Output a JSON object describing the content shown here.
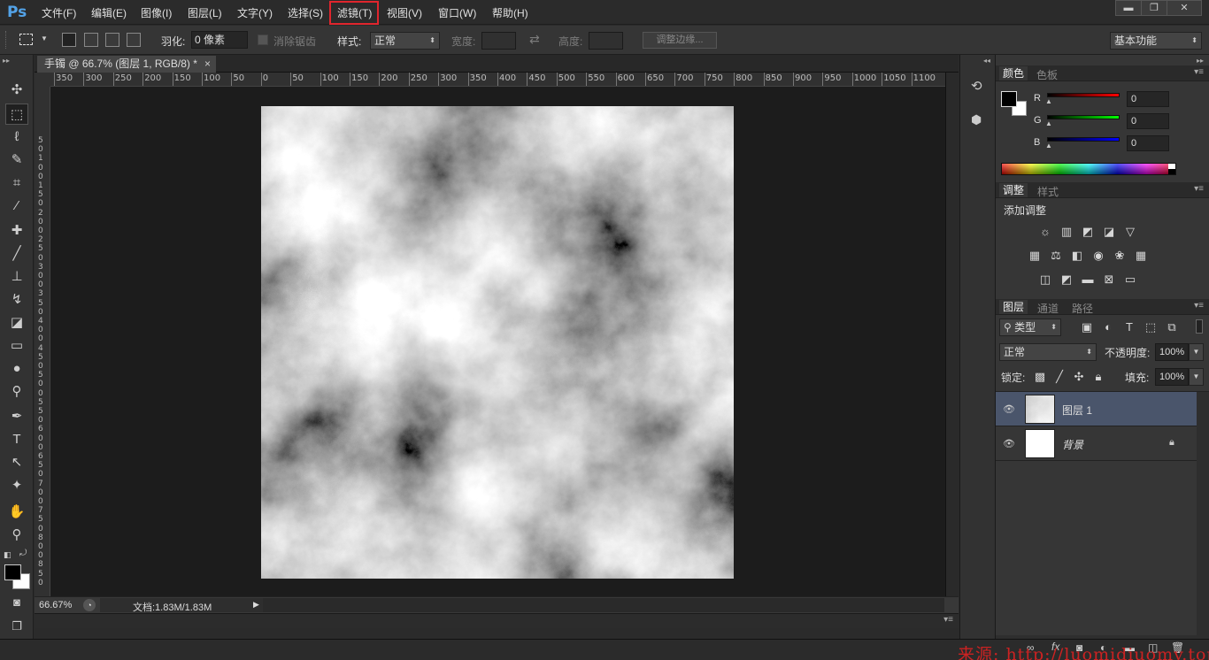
{
  "app": {
    "logo": "Ps"
  },
  "menu": [
    "文件(F)",
    "编辑(E)",
    "图像(I)",
    "图层(L)",
    "文字(Y)",
    "选择(S)",
    "滤镜(T)",
    "视图(V)",
    "窗口(W)",
    "帮助(H)"
  ],
  "window_controls": {
    "minimize": "▬",
    "restore": "❐",
    "close": "✕"
  },
  "options": {
    "feather_label": "羽化:",
    "feather_value": "0 像素",
    "antialias_label": "消除锯齿",
    "style_label": "样式:",
    "style_value": "正常",
    "width_label": "宽度:",
    "height_label": "高度:",
    "refine_edge": "调整边缘...",
    "workspace": "基本功能"
  },
  "document": {
    "tab_title": "手镯 @ 66.7% (图层 1, RGB/8) *",
    "tab_close": "×",
    "zoom": "66.67%",
    "doc_info": "文档:1.83M/1.83M"
  },
  "ruler_h": [
    "350",
    "300",
    "250",
    "200",
    "150",
    "100",
    "50",
    "0",
    "50",
    "100",
    "150",
    "200",
    "250",
    "300",
    "350",
    "400",
    "450",
    "500",
    "550",
    "600",
    "650",
    "700",
    "750",
    "800",
    "850",
    "900",
    "950",
    "1000",
    "1050",
    "1100"
  ],
  "ruler_v": [
    "5",
    "0",
    "1",
    "0",
    "0",
    "1",
    "5",
    "0",
    "2",
    "0",
    "0",
    "2",
    "5",
    "0",
    "3",
    "0",
    "0",
    "3",
    "5",
    "0",
    "4",
    "0",
    "0",
    "4",
    "5",
    "0",
    "5",
    "0",
    "0",
    "5",
    "5",
    "0",
    "6",
    "0",
    "0",
    "6",
    "5",
    "0",
    "7",
    "0",
    "0",
    "7",
    "5",
    "0",
    "8",
    "0",
    "0",
    "8",
    "5",
    "0"
  ],
  "color_panel": {
    "tabs": [
      "颜色",
      "色板"
    ],
    "r_label": "R",
    "g_label": "G",
    "b_label": "B",
    "r": "0",
    "g": "0",
    "b": "0"
  },
  "adjust_panel": {
    "tabs": [
      "调整",
      "样式"
    ],
    "title": "添加调整"
  },
  "layers_panel": {
    "tabs": [
      "图层",
      "通道",
      "路径"
    ],
    "filter_kind": "类型",
    "blend_mode": "正常",
    "opacity_label": "不透明度:",
    "opacity": "100%",
    "lock_label": "锁定:",
    "fill_label": "填充:",
    "fill": "100%",
    "layers": [
      {
        "name": "图层 1",
        "selected": true
      },
      {
        "name": "背景",
        "selected": false
      }
    ]
  },
  "watermark": "来源: http://luomidiuomy.top",
  "colors": {
    "accent": "#e0252d",
    "layer_selected": "#4a556b",
    "ps_blue": "#53a3e8"
  }
}
